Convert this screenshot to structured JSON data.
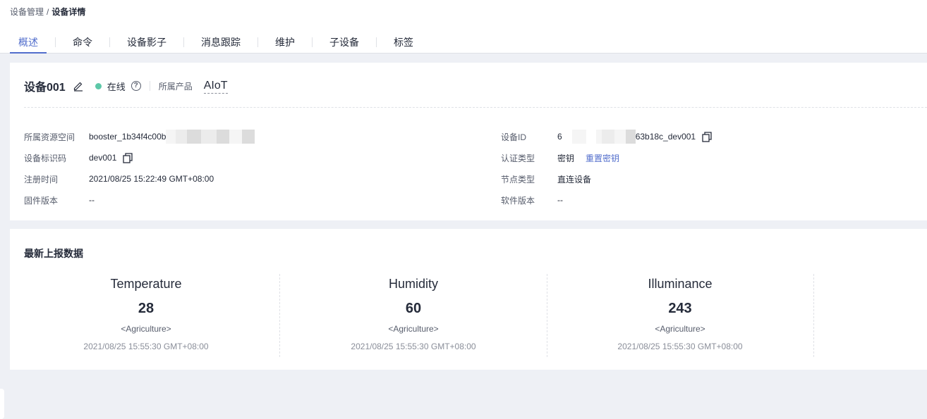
{
  "breadcrumb": {
    "parent": "设备管理",
    "separator": "/",
    "current": "设备详情"
  },
  "tabs": [
    {
      "label": "概述",
      "active": true
    },
    {
      "label": "命令"
    },
    {
      "label": "设备影子"
    },
    {
      "label": "消息跟踪"
    },
    {
      "label": "维护"
    },
    {
      "label": "子设备"
    },
    {
      "label": "标签"
    }
  ],
  "device": {
    "name": "设备001",
    "status": "在线",
    "status_color": "#5dc8a8",
    "product_label": "所属产品",
    "product_value": "AIoT"
  },
  "info_left": [
    {
      "label": "所属资源空间",
      "value": "booster_1b34f4c00b"
    },
    {
      "label": "设备标识码",
      "value": "dev001"
    },
    {
      "label": "注册时间",
      "value": "2021/08/25 15:22:49 GMT+08:00"
    },
    {
      "label": "固件版本",
      "value": "--"
    }
  ],
  "info_right": [
    {
      "label": "设备ID",
      "value_prefix": "6",
      "value_suffix": "63b18c_dev001"
    },
    {
      "label": "认证类型",
      "value": "密钥",
      "link": "重置密钥"
    },
    {
      "label": "节点类型",
      "value": "直连设备"
    },
    {
      "label": "软件版本",
      "value": "--"
    }
  ],
  "latest": {
    "title": "最新上报数据",
    "metrics": [
      {
        "name": "Temperature",
        "value": "28",
        "service": "<Agriculture>",
        "time": "2021/08/25 15:55:30 GMT+08:00"
      },
      {
        "name": "Humidity",
        "value": "60",
        "service": "<Agriculture>",
        "time": "2021/08/25 15:55:30 GMT+08:00"
      },
      {
        "name": "Illuminance",
        "value": "243",
        "service": "<Agriculture>",
        "time": "2021/08/25 15:55:30 GMT+08:00"
      }
    ]
  },
  "colors": {
    "accent": "#526ecc",
    "online": "#5dc8a8",
    "background": "#eef0f5"
  },
  "icons": {
    "edit": "pencil-icon",
    "help": "question-circle-icon",
    "copy": "copy-icon"
  }
}
